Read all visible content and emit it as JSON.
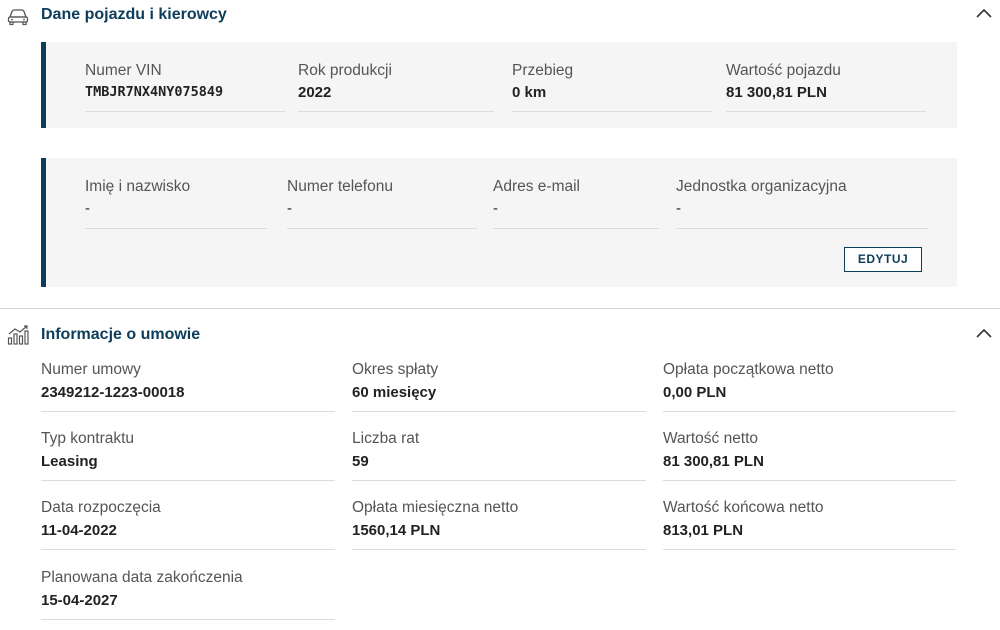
{
  "vehicle_section": {
    "title": "Dane pojazdu i kierowcy",
    "vehicle": {
      "vin_label": "Numer VIN",
      "vin_value": "TMBJR7NX4NY075849",
      "year_label": "Rok produkcji",
      "year_value": "2022",
      "mileage_label": "Przebieg",
      "mileage_value": "0 km",
      "value_label": "Wartość pojazdu",
      "value_value": "81 300,81 PLN"
    },
    "driver": {
      "name_label": "Imię i nazwisko",
      "name_value": "-",
      "phone_label": "Numer telefonu",
      "phone_value": "-",
      "email_label": "Adres e-mail",
      "email_value": "-",
      "unit_label": "Jednostka organizacyjna",
      "unit_value": "-",
      "edit_label": "EDYTUJ"
    }
  },
  "contract_section": {
    "title": "Informacje o umowie",
    "fields": [
      {
        "label": "Numer umowy",
        "value": "2349212-1223-00018"
      },
      {
        "label": "Okres spłaty",
        "value": "60 miesięcy"
      },
      {
        "label": "Opłata początkowa netto",
        "value": "0,00 PLN"
      },
      {
        "label": "Typ kontraktu",
        "value": "Leasing"
      },
      {
        "label": "Liczba rat",
        "value": "59"
      },
      {
        "label": "Wartość netto",
        "value": "81 300,81 PLN"
      },
      {
        "label": "Data rozpoczęcia",
        "value": "11-04-2022"
      },
      {
        "label": "Opłata miesięczna netto",
        "value": "1560,14 PLN"
      },
      {
        "label": "Wartość końcowa netto",
        "value": "813,01 PLN"
      },
      {
        "label": "Planowana data zakończenia",
        "value": "15-04-2027"
      }
    ]
  },
  "icons": {
    "vehicle": "car-icon",
    "contract": "chart-icon",
    "collapse": "chevron-up-icon"
  },
  "colors": {
    "accent": "#0c3d5a",
    "panel_bg": "#f5f5f5"
  }
}
